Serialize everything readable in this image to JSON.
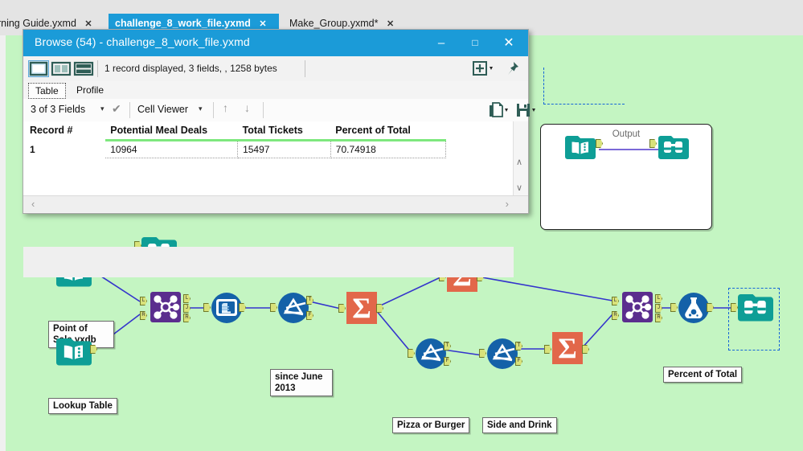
{
  "app": {
    "tabs": [
      {
        "label": "arning Guide.yxmd",
        "close": "✕",
        "active": false
      },
      {
        "label": "challenge_8_work_file.yxmd",
        "close": "✕",
        "active": true
      },
      {
        "label": "Make_Group.yxmd*",
        "close": "✕",
        "active": false
      }
    ],
    "canvas_color": "#c4f5c2"
  },
  "browse_window": {
    "title": "Browse (54) - challenge_8_work_file.yxmd",
    "titlebar_color": "#1b9bd8",
    "minimize_label": "–",
    "maximize_label": "□",
    "close_label": "✕",
    "toolbar": {
      "layout_single_icon": "layout-single-icon",
      "layout_columns_icon": "layout-columns-icon",
      "layout_rows_icon": "layout-rows-icon",
      "record_status": "1 record displayed, 3 fields, , 1258 bytes",
      "add_field_icon": "add-field-icon",
      "add_field_caret": "▾",
      "pin_icon": "pin-icon"
    },
    "view_tabs": [
      {
        "label": "Table",
        "active": true
      },
      {
        "label": "Profile",
        "active": false
      }
    ],
    "field_bar": {
      "fields_label": "3 of 3 Fields",
      "fields_caret": "▾",
      "check_icon": "✔",
      "cell_viewer_label": "Cell Viewer",
      "cell_viewer_caret": "▾",
      "sort_asc_icon": "↑",
      "sort_desc_icon": "↓",
      "copy_icon": "copy-icon",
      "copy_caret": "▾",
      "save_icon": "save-icon",
      "save_caret": "▾"
    },
    "grid": {
      "columns": [
        "Record #",
        "Potential Meal Deals",
        "Total Tickets",
        "Percent of Total"
      ],
      "rows": [
        {
          "record": "1",
          "potential_meal_deals": "10964",
          "total_tickets": "15497",
          "percent_of_total": "70.74918"
        }
      ],
      "header_underline_color": "#7ee87e",
      "scroll_up": "∧",
      "scroll_down": "∨",
      "scroll_left": "‹",
      "scroll_right": "›"
    }
  },
  "workflow": {
    "output_container": {
      "title": "Output"
    },
    "tools": [
      {
        "id": "t-browse-out",
        "name": "browse-tool",
        "label": ""
      },
      {
        "id": "t-input-out",
        "name": "input-data-tool",
        "label": ""
      },
      {
        "id": "t-browse-top",
        "name": "browse-tool",
        "label": ""
      },
      {
        "id": "t-input-pos",
        "name": "input-data-tool",
        "label": "Point of\nSale.yxdb"
      },
      {
        "id": "t-input-lookup",
        "name": "input-data-tool",
        "label": "Lookup Table"
      },
      {
        "id": "t-join",
        "name": "join-tool",
        "label": ""
      },
      {
        "id": "t-select",
        "name": "select-tool",
        "label": ""
      },
      {
        "id": "t-filter1",
        "name": "filter-tool",
        "label": "since June\n2013"
      },
      {
        "id": "t-summarize1",
        "name": "summarize-tool",
        "label": ""
      },
      {
        "id": "t-summarize2",
        "name": "summarize-tool",
        "label": ""
      },
      {
        "id": "t-filter2",
        "name": "filter-tool",
        "label": "Pizza or Burger"
      },
      {
        "id": "t-filter3",
        "name": "filter-tool",
        "label": "Side and Drink"
      },
      {
        "id": "t-summarize3",
        "name": "summarize-tool",
        "label": ""
      },
      {
        "id": "t-join2",
        "name": "join-tool",
        "label": ""
      },
      {
        "id": "t-formula",
        "name": "formula-tool",
        "label": "Percent of Total"
      },
      {
        "id": "t-browse-end",
        "name": "browse-tool",
        "label": ""
      }
    ],
    "annotations": [
      {
        "id": "a-pos",
        "text": "Point of\nSale.yxdb"
      },
      {
        "id": "a-lookup",
        "text": "Lookup Table"
      },
      {
        "id": "a-since",
        "text": "since June\n2013"
      },
      {
        "id": "a-pizza",
        "text": "Pizza or Burger"
      },
      {
        "id": "a-side",
        "text": "Side and Drink"
      },
      {
        "id": "a-percent",
        "text": "Percent of Total"
      }
    ],
    "anchor_labels": {
      "left": "L",
      "join": "J",
      "right": "R",
      "true": "T",
      "false": "F"
    }
  }
}
